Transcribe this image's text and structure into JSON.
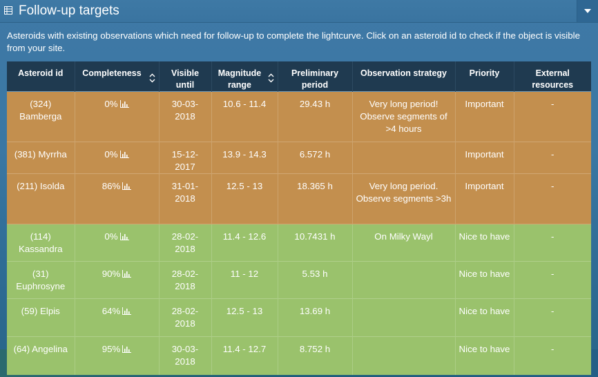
{
  "panel": {
    "title": "Follow-up targets",
    "title_icon": "table-icon",
    "collapse_icon": "chevron-down-icon",
    "description": "Asteroids with existing observations which need for follow-up to complete the lightcurve. Click on an asteroid id to check if the object is visible from your site."
  },
  "table": {
    "headers": {
      "asteroid_id": "Asteroid id",
      "completeness": "Completeness",
      "visible_until": "Visible until",
      "magnitude_range": "Magnitude range",
      "preliminary_period": "Preliminary period",
      "observation_strategy": "Observation strategy",
      "priority": "Priority",
      "external_resources": "External resources"
    },
    "rows": [
      {
        "id": "(324) Bamberga",
        "completeness": "0%",
        "visible_until": "30-03-2018",
        "magnitude": "10.6 - 11.4",
        "period": "29.43 h",
        "strategy": "Very long period! Observe segments of >4 hours",
        "priority": "Important",
        "external": "-"
      },
      {
        "id": "(381) Myrrha",
        "completeness": "0%",
        "visible_until": "15-12-2017",
        "magnitude": "13.9 - 14.3",
        "period": "6.572 h",
        "strategy": "",
        "priority": "Important",
        "external": "-"
      },
      {
        "id": "(211) Isolda",
        "completeness": "86%",
        "visible_until": "31-01-2018",
        "magnitude": "12.5 - 13",
        "period": "18.365 h",
        "strategy": "Very long period. Observe segments >3h",
        "priority": "Important",
        "external": "-"
      },
      {
        "id": "(114) Kassandra",
        "completeness": "0%",
        "visible_until": "28-02-2018",
        "magnitude": "11.4 - 12.6",
        "period": "10.7431 h",
        "strategy": "On Milky Wayl",
        "priority": "Nice to have",
        "external": "-"
      },
      {
        "id": "(31) Euphrosyne",
        "completeness": "90%",
        "visible_until": "28-02-2018",
        "magnitude": "11 - 12",
        "period": "5.53 h",
        "strategy": "",
        "priority": "Nice to have",
        "external": "-"
      },
      {
        "id": "(59) Elpis",
        "completeness": "64%",
        "visible_until": "28-02-2018",
        "magnitude": "12.5 - 13",
        "period": "13.69 h",
        "strategy": "",
        "priority": "Nice to have",
        "external": "-"
      },
      {
        "id": "(64) Angelina",
        "completeness": "95%",
        "visible_until": "30-03-2018",
        "magnitude": "11.4 - 12.7",
        "period": "8.752 h",
        "strategy": "",
        "priority": "Nice to have",
        "external": "-"
      }
    ]
  },
  "colors": {
    "important_row": "#c38f4e",
    "nice_row": "#9ac26c",
    "header_bg": "#1f3a50",
    "panel_bg": "#3e79a5"
  }
}
